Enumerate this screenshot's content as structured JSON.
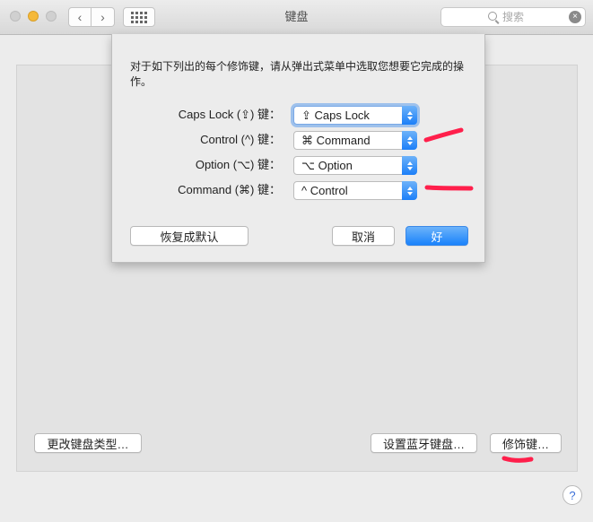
{
  "window": {
    "title": "键盘",
    "back_glyph": "‹",
    "forward_glyph": "›",
    "grid_icon": "grid-icon"
  },
  "search": {
    "placeholder": "搜索",
    "clear_glyph": "×"
  },
  "colors": {
    "accent": "#1a82fb",
    "annotation": "#ff1f4b",
    "traffic_minimize": "#f5b93a"
  },
  "sheet": {
    "description": "对于如下列出的每个修饰键，请从弹出式菜单中选取您想要它完成的操作。",
    "rows": [
      {
        "label": "Caps Lock (⇪) 键：",
        "value": "⇪ Caps Lock"
      },
      {
        "label": "Control (^) 键：",
        "value": "⌘ Command"
      },
      {
        "label": "Option (⌥) 键：",
        "value": "⌥ Option"
      },
      {
        "label": "Command (⌘) 键：",
        "value": "^ Control"
      }
    ],
    "restore_defaults": "恢复成默认",
    "cancel": "取消",
    "ok": "好"
  },
  "panel": {
    "change_keyboard_type": "更改键盘类型…",
    "setup_bluetooth_keyboard": "设置蓝牙键盘…",
    "modifier_keys": "修饰键…"
  },
  "help": {
    "glyph": "?"
  }
}
